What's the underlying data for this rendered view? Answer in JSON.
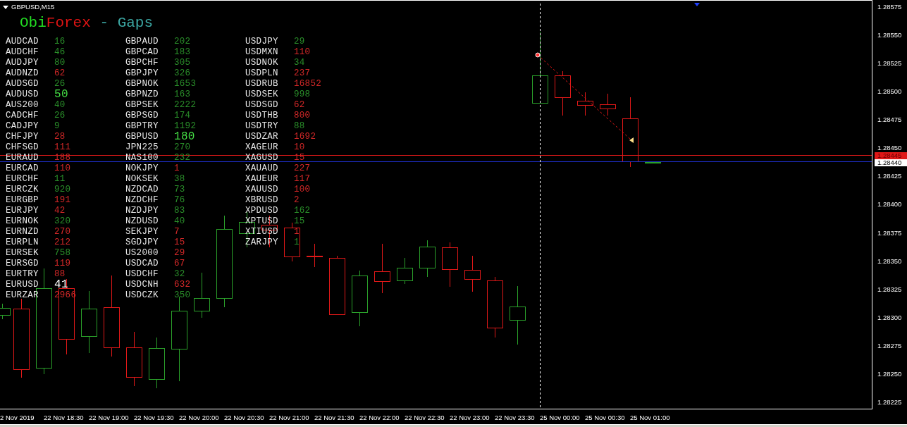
{
  "chart": {
    "title": "GBPUSD,M15"
  },
  "indicator": {
    "title_parts": [
      {
        "text": "Obi",
        "color": "#22dd22"
      },
      {
        "text": "Forex",
        "color": "#e01414"
      },
      {
        "text": " - Gaps",
        "color": "#3ca7a3"
      }
    ],
    "columns": [
      [
        {
          "symbol": "AUDCAD",
          "gap": "16",
          "color": "#2a8f2a",
          "emphasized": false
        },
        {
          "symbol": "AUDCHF",
          "gap": "46",
          "color": "#2a8f2a",
          "emphasized": false
        },
        {
          "symbol": "AUDJPY",
          "gap": "80",
          "color": "#2a8f2a",
          "emphasized": false
        },
        {
          "symbol": "AUDNZD",
          "gap": "62",
          "color": "#d42828",
          "emphasized": false
        },
        {
          "symbol": "AUDSGD",
          "gap": "26",
          "color": "#2a8f2a",
          "emphasized": false
        },
        {
          "symbol": "AUDUSD",
          "gap": "50",
          "color": "#44dd44",
          "emphasized": true
        },
        {
          "symbol": "AUS200",
          "gap": "40",
          "color": "#2a8f2a",
          "emphasized": false
        },
        {
          "symbol": "CADCHF",
          "gap": "26",
          "color": "#2a8f2a",
          "emphasized": false
        },
        {
          "symbol": "CADJPY",
          "gap": "9",
          "color": "#2a8f2a",
          "emphasized": false
        },
        {
          "symbol": "CHFJPY",
          "gap": "28",
          "color": "#d42828",
          "emphasized": false
        },
        {
          "symbol": "CHFSGD",
          "gap": "111",
          "color": "#d42828",
          "emphasized": false
        },
        {
          "symbol": "EURAUD",
          "gap": "188",
          "color": "#d42828",
          "emphasized": false
        },
        {
          "symbol": "EURCAD",
          "gap": "110",
          "color": "#d42828",
          "emphasized": false
        },
        {
          "symbol": "EURCHF",
          "gap": "11",
          "color": "#2a8f2a",
          "emphasized": false
        },
        {
          "symbol": "EURCZK",
          "gap": "920",
          "color": "#2a8f2a",
          "emphasized": false
        },
        {
          "symbol": "EURGBP",
          "gap": "191",
          "color": "#d42828",
          "emphasized": false
        },
        {
          "symbol": "EURJPY",
          "gap": "42",
          "color": "#d42828",
          "emphasized": false
        },
        {
          "symbol": "EURNOK",
          "gap": "320",
          "color": "#2a8f2a",
          "emphasized": false
        },
        {
          "symbol": "EURNZD",
          "gap": "270",
          "color": "#d42828",
          "emphasized": false
        },
        {
          "symbol": "EURPLN",
          "gap": "212",
          "color": "#d42828",
          "emphasized": false
        },
        {
          "symbol": "EURSEK",
          "gap": "758",
          "color": "#2a8f2a",
          "emphasized": false
        },
        {
          "symbol": "EURSGD",
          "gap": "119",
          "color": "#d42828",
          "emphasized": false
        },
        {
          "symbol": "EURTRY",
          "gap": "88",
          "color": "#d42828",
          "emphasized": false
        },
        {
          "symbol": "EURUSD",
          "gap": "41",
          "color": "#ffffff",
          "emphasized": true
        },
        {
          "symbol": "EURZAR",
          "gap": "2966",
          "color": "#d42828",
          "emphasized": false
        }
      ],
      [
        {
          "symbol": "GBPAUD",
          "gap": "202",
          "color": "#2a8f2a",
          "emphasized": false
        },
        {
          "symbol": "GBPCAD",
          "gap": "183",
          "color": "#2a8f2a",
          "emphasized": false
        },
        {
          "symbol": "GBPCHF",
          "gap": "305",
          "color": "#2a8f2a",
          "emphasized": false
        },
        {
          "symbol": "GBPJPY",
          "gap": "326",
          "color": "#2a8f2a",
          "emphasized": false
        },
        {
          "symbol": "GBPNOK",
          "gap": "1653",
          "color": "#2a8f2a",
          "emphasized": false
        },
        {
          "symbol": "GBPNZD",
          "gap": "163",
          "color": "#2a8f2a",
          "emphasized": false
        },
        {
          "symbol": "GBPSEK",
          "gap": "2222",
          "color": "#2a8f2a",
          "emphasized": false
        },
        {
          "symbol": "GBPSGD",
          "gap": "174",
          "color": "#2a8f2a",
          "emphasized": false
        },
        {
          "symbol": "GBPTRY",
          "gap": "1192",
          "color": "#2a8f2a",
          "emphasized": false
        },
        {
          "symbol": "GBPUSD",
          "gap": "180",
          "color": "#44dd44",
          "emphasized": true
        },
        {
          "symbol": "JPN225",
          "gap": "270",
          "color": "#2a8f2a",
          "emphasized": false
        },
        {
          "symbol": "NAS100",
          "gap": "232",
          "color": "#2a8f2a",
          "emphasized": false
        },
        {
          "symbol": "NOKJPY",
          "gap": "1",
          "color": "#d42828",
          "emphasized": false
        },
        {
          "symbol": "NOKSEK",
          "gap": "38",
          "color": "#2a8f2a",
          "emphasized": false
        },
        {
          "symbol": "NZDCAD",
          "gap": "73",
          "color": "#2a8f2a",
          "emphasized": false
        },
        {
          "symbol": "NZDCHF",
          "gap": "76",
          "color": "#2a8f2a",
          "emphasized": false
        },
        {
          "symbol": "NZDJPY",
          "gap": "83",
          "color": "#2a8f2a",
          "emphasized": false
        },
        {
          "symbol": "NZDUSD",
          "gap": "40",
          "color": "#2a8f2a",
          "emphasized": false
        },
        {
          "symbol": "SEKJPY",
          "gap": "7",
          "color": "#d42828",
          "emphasized": false
        },
        {
          "symbol": "SGDJPY",
          "gap": "15",
          "color": "#d42828",
          "emphasized": false
        },
        {
          "symbol": "US2000",
          "gap": "29",
          "color": "#d42828",
          "emphasized": false
        },
        {
          "symbol": "USDCAD",
          "gap": "67",
          "color": "#d42828",
          "emphasized": false
        },
        {
          "symbol": "USDCHF",
          "gap": "32",
          "color": "#2a8f2a",
          "emphasized": false
        },
        {
          "symbol": "USDCNH",
          "gap": "632",
          "color": "#d42828",
          "emphasized": false
        },
        {
          "symbol": "USDCZK",
          "gap": "350",
          "color": "#2a8f2a",
          "emphasized": false
        }
      ],
      [
        {
          "symbol": "USDJPY",
          "gap": "29",
          "color": "#2a8f2a",
          "emphasized": false
        },
        {
          "symbol": "USDMXN",
          "gap": "110",
          "color": "#d42828",
          "emphasized": false
        },
        {
          "symbol": "USDNOK",
          "gap": "34",
          "color": "#2a8f2a",
          "emphasized": false
        },
        {
          "symbol": "USDPLN",
          "gap": "237",
          "color": "#d42828",
          "emphasized": false
        },
        {
          "symbol": "USDRUB",
          "gap": "16852",
          "color": "#d42828",
          "emphasized": false
        },
        {
          "symbol": "USDSEK",
          "gap": "998",
          "color": "#2a8f2a",
          "emphasized": false
        },
        {
          "symbol": "USDSGD",
          "gap": "62",
          "color": "#d42828",
          "emphasized": false
        },
        {
          "symbol": "USDTHB",
          "gap": "800",
          "color": "#d42828",
          "emphasized": false
        },
        {
          "symbol": "USDTRY",
          "gap": "88",
          "color": "#2a8f2a",
          "emphasized": false
        },
        {
          "symbol": "USDZAR",
          "gap": "1692",
          "color": "#d42828",
          "emphasized": false
        },
        {
          "symbol": "XAGEUR",
          "gap": "10",
          "color": "#d42828",
          "emphasized": false
        },
        {
          "symbol": "XAGUSD",
          "gap": "15",
          "color": "#d42828",
          "emphasized": false
        },
        {
          "symbol": "XAUAUD",
          "gap": "227",
          "color": "#d42828",
          "emphasized": false
        },
        {
          "symbol": "XAUEUR",
          "gap": "117",
          "color": "#d42828",
          "emphasized": false
        },
        {
          "symbol": "XAUUSD",
          "gap": "100",
          "color": "#d42828",
          "emphasized": false
        },
        {
          "symbol": "XBRUSD",
          "gap": "2",
          "color": "#d42828",
          "emphasized": false
        },
        {
          "symbol": "XPDUSD",
          "gap": "162",
          "color": "#2a8f2a",
          "emphasized": false
        },
        {
          "symbol": "XPTUSD",
          "gap": "15",
          "color": "#2a8f2a",
          "emphasized": false
        },
        {
          "symbol": "XTIUSD",
          "gap": "1",
          "color": "#d42828",
          "emphasized": false
        },
        {
          "symbol": "ZARJPY",
          "gap": "1",
          "color": "#2a8f2a",
          "emphasized": false
        }
      ]
    ]
  },
  "price_axis": {
    "labels": [
      "1.28575",
      "1.28550",
      "1.28525",
      "1.28500",
      "1.28475",
      "1.28450",
      "1.28425",
      "1.28400",
      "1.28375",
      "1.28350",
      "1.28325",
      "1.28300",
      "1.28275",
      "1.28250",
      "1.28225"
    ],
    "markers": [
      {
        "kind": "bid",
        "price": "1.28445"
      },
      {
        "kind": "ask",
        "price": "1.28440"
      }
    ]
  },
  "time_axis": {
    "labels": [
      "2 Nov 2019",
      "22 Nov 18:30",
      "22 Nov 19:00",
      "22 Nov 19:30",
      "22 Nov 20:00",
      "22 Nov 20:30",
      "22 Nov 21:00",
      "22 Nov 21:30",
      "22 Nov 22:00",
      "22 Nov 22:30",
      "22 Nov 23:00",
      "22 Nov 23:30",
      "25 Nov 00:00",
      "25 Nov 00:30",
      "25 Nov 01:00"
    ]
  }
}
